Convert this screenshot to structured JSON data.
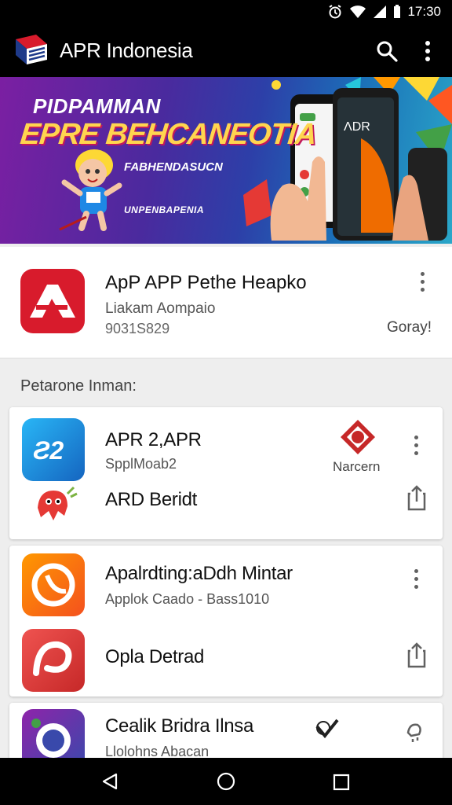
{
  "status_bar": {
    "time": "17:30"
  },
  "app_bar": {
    "title": "APR Indonesia"
  },
  "banner": {
    "line1": "PIDPAMMAN",
    "line2": "EPRE BEHCANEOTIA",
    "line3": "FABHENDASUCN",
    "line4": "UNPENBAPENIA",
    "phone_text": "ΛDR"
  },
  "featured": {
    "title": "ApP APP Pethe Heapko",
    "subtitle": "Liakam Aompaio",
    "number": "9031S829",
    "tag": "Goray!"
  },
  "section": {
    "header": "Petarone Inman:"
  },
  "cards": [
    {
      "rows": [
        {
          "title": "APR 2,APR",
          "subtitle": "SpplMoab2",
          "badge_label": "Narcern"
        },
        {
          "title": "ARD Beridt"
        }
      ]
    },
    {
      "rows": [
        {
          "title": "Apalrdting:aDdh Mintar",
          "subtitle": "Applok Caado - Bass1010"
        },
        {
          "title": "Opla Detrad"
        }
      ]
    },
    {
      "rows": [
        {
          "title": "Cealik Bridra Ilnsa",
          "subtitle": "Llolohns Abacan"
        }
      ]
    }
  ],
  "colors": {
    "primary_bar": "#000000",
    "accent_red": "#d81b2c",
    "accent_blue": "#1e88e5",
    "accent_orange": "#f4511e",
    "banner_yellow": "#ffd54f"
  }
}
